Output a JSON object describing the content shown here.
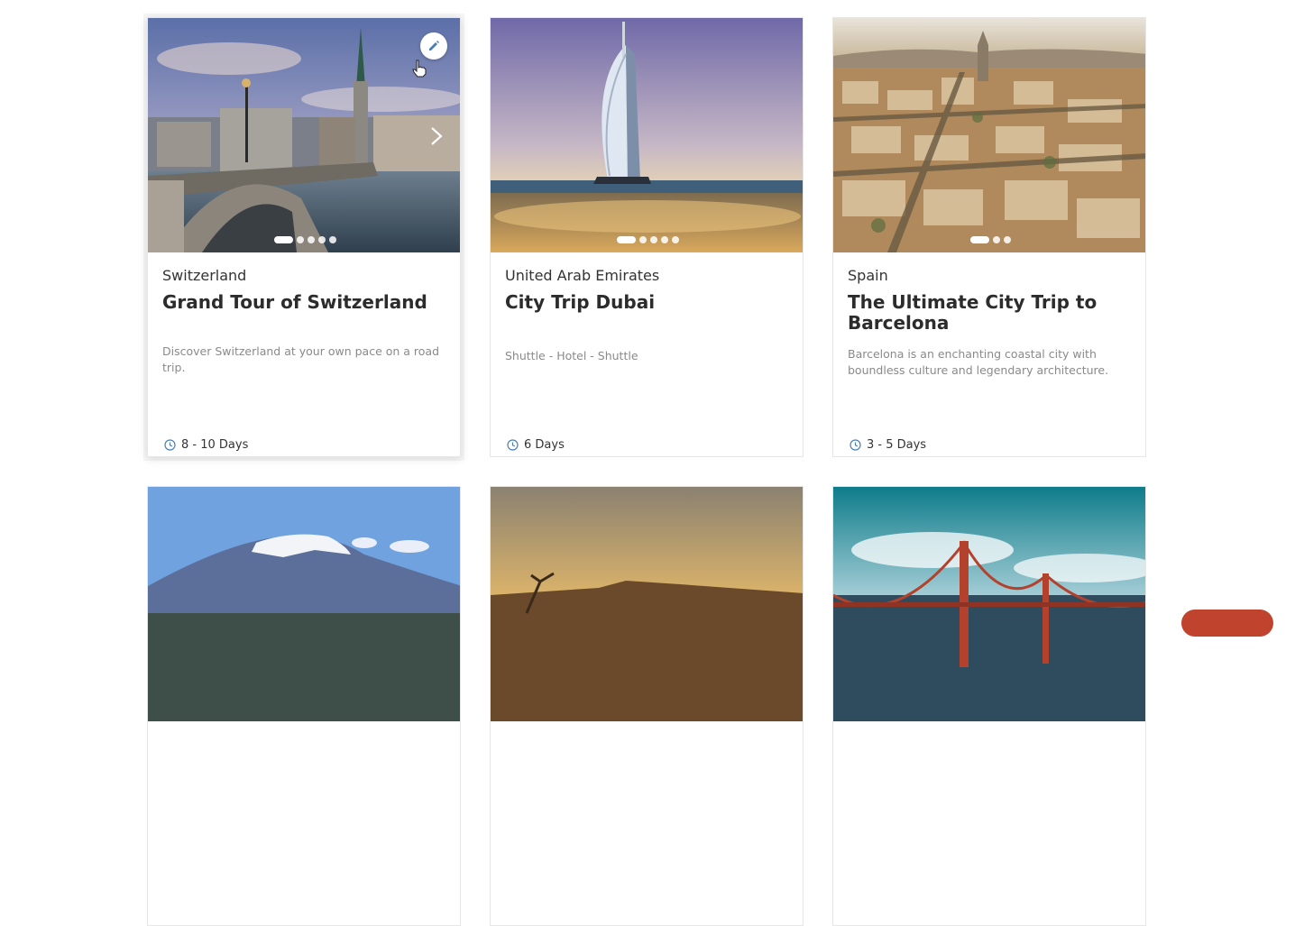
{
  "cards": [
    {
      "country": "Switzerland",
      "title": "Grand Tour of Switzerland",
      "description": "Discover Switzerland at your own pace on a road trip.",
      "duration": "8 - 10 Days",
      "slides": 5,
      "active_slide": 1
    },
    {
      "country": "United Arab Emirates",
      "title": "City Trip Dubai",
      "description": "Shuttle - Hotel - Shuttle",
      "duration": "6 Days",
      "slides": 5,
      "active_slide": 1
    },
    {
      "country": "Spain",
      "title": "The Ultimate City Trip to Barcelona",
      "description": "Barcelona is an enchanting coastal city with boundless culture and legendary architecture.",
      "duration": "3 - 5 Days",
      "slides": 3,
      "active_slide": 1
    }
  ],
  "second_row_images": [
    "mountain-kilimanjaro-image",
    "savanna-sunset-image",
    "golden-gate-bridge-image"
  ],
  "icons": {
    "edit": "pencil-icon",
    "next": "chevron-right-icon",
    "duration": "clock-icon"
  },
  "colors": {
    "accent": "#4a7fb5",
    "fab": "#c0432e"
  }
}
